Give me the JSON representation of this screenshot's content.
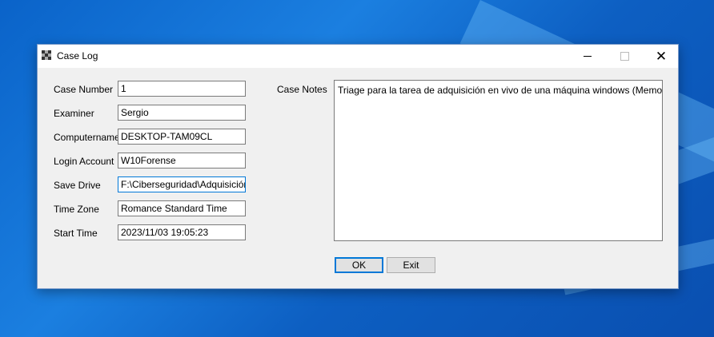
{
  "window": {
    "title": "Case Log"
  },
  "form": {
    "case_number_label": "Case Number",
    "case_number": "1",
    "examiner_label": "Examiner",
    "examiner": "Sergio",
    "computername_label": "Computername",
    "computername": "DESKTOP-TAM09CL",
    "login_account_label": "Login Account",
    "login_account": "W10Forense",
    "save_drive_label": "Save Drive",
    "save_drive": "F:\\Ciberseguridad\\Adquisición W",
    "time_zone_label": "Time Zone",
    "time_zone": "Romance Standard Time",
    "start_time_label": "Start Time",
    "start_time": "2023/11/03 19:05:23",
    "case_notes_label": "Case Notes",
    "case_notes": "Triage para la tarea de adquisición en vivo de una máquina windows (Memoria Volatil"
  },
  "buttons": {
    "ok": "OK",
    "exit": "Exit"
  },
  "colors": {
    "accent": "#0078d7",
    "desktop": "#0a63c9"
  }
}
